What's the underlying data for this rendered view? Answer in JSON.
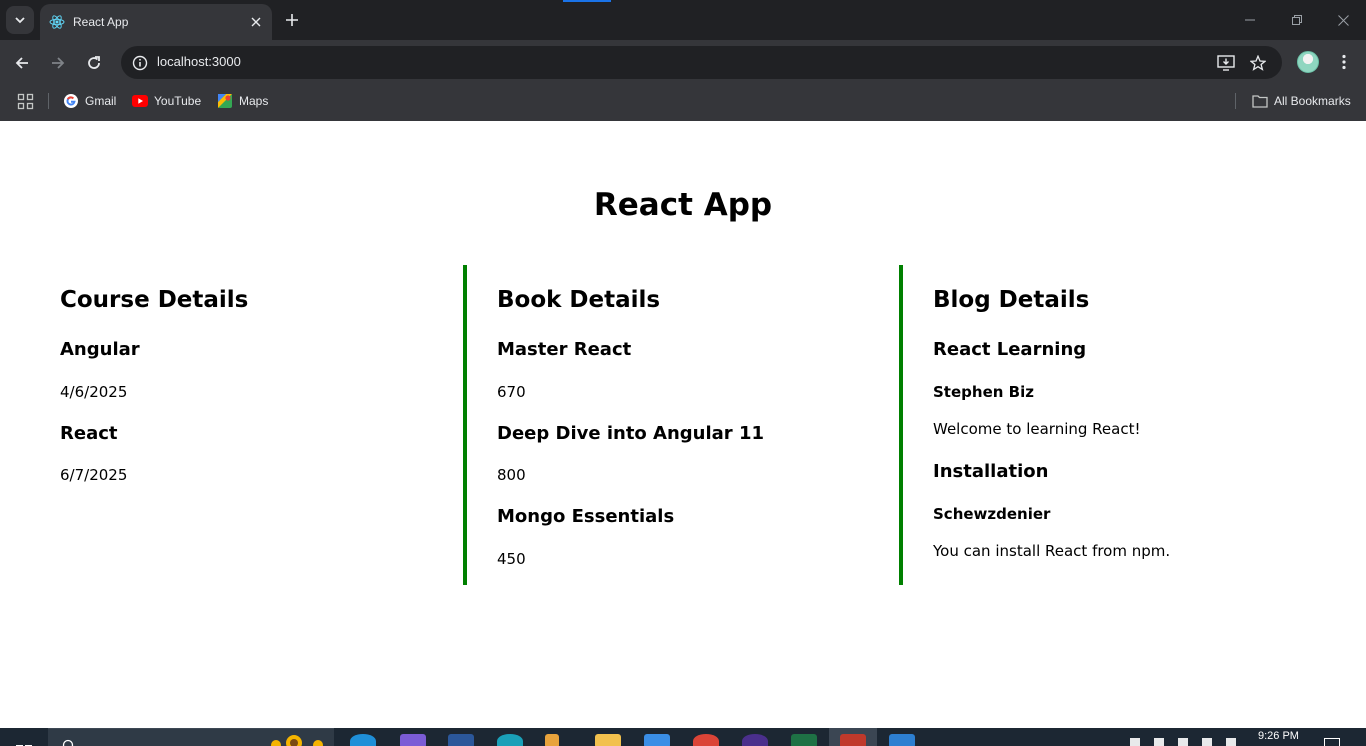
{
  "browser": {
    "tab_title": "React App",
    "url": "localhost:3000",
    "bookmarks": [
      {
        "label": "Gmail",
        "icon": "google-icon"
      },
      {
        "label": "YouTube",
        "icon": "youtube-icon"
      },
      {
        "label": "Maps",
        "icon": "maps-icon"
      }
    ],
    "all_bookmarks_label": "All Bookmarks"
  },
  "page": {
    "title": "React App",
    "accent_color": "#008000",
    "course": {
      "heading": "Course Details",
      "items": [
        {
          "name": "Angular",
          "date": "4/6/2025"
        },
        {
          "name": "React",
          "date": "6/7/2025"
        }
      ]
    },
    "book": {
      "heading": "Book Details",
      "items": [
        {
          "name": "Master React",
          "price": "670"
        },
        {
          "name": "Deep Dive into Angular 11",
          "price": "800"
        },
        {
          "name": "Mongo Essentials",
          "price": "450"
        }
      ]
    },
    "blog": {
      "heading": "Blog Details",
      "items": [
        {
          "title": "React Learning",
          "author": "Stephen Biz",
          "content": "Welcome to learning React!"
        },
        {
          "title": "Installation",
          "author": "Schewzdenier",
          "content": "You can install React from npm."
        }
      ]
    }
  },
  "taskbar": {
    "time": "9:26 PM"
  }
}
